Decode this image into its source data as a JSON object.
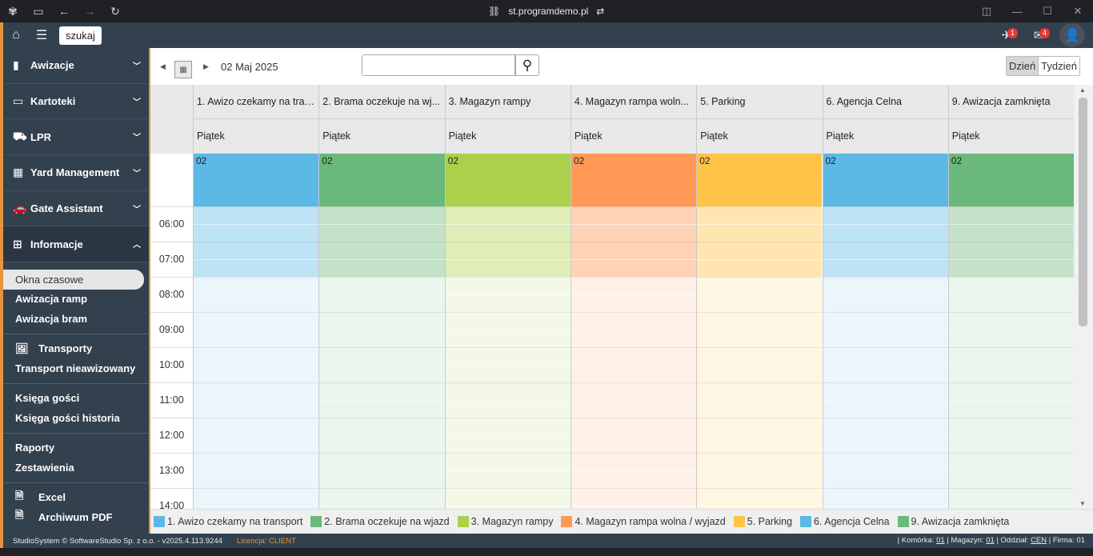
{
  "browser": {
    "url": "st.programdemo.pl"
  },
  "topbar": {
    "search_label": "szukaj",
    "notif1_count": "1",
    "notif2_count": "4"
  },
  "sidebar": {
    "sections": [
      {
        "label": "Awizacje",
        "icon": "clipboard-icon"
      },
      {
        "label": "Kartoteki",
        "icon": "folder-icon"
      },
      {
        "label": "LPR",
        "icon": "truck-icon"
      },
      {
        "label": "Yard Management",
        "icon": "grid-icon"
      },
      {
        "label": "Gate Assistant",
        "icon": "car-icon"
      },
      {
        "label": "Informacje",
        "icon": "sitemap-icon"
      }
    ],
    "items": {
      "okna": "Okna czasowe",
      "awizacja_ramp": "Awizacja ramp",
      "awizacja_bram": "Awizacja bram",
      "transporty": "Transporty",
      "transport_nieaw": "Transport nieawizowany",
      "ksiega": "Księga gości",
      "ksiega_hist": "Księga gości historia",
      "raporty": "Raporty",
      "zestawienia": "Zestawienia",
      "excel": "Excel",
      "archiwum": "Archiwum PDF"
    }
  },
  "toolbar": {
    "date": "02 Maj 2025",
    "search_value": "",
    "view_day": "Dzień",
    "view_week": "Tydzień"
  },
  "calendar": {
    "day_label": "Piątek",
    "allday_number": "02",
    "columns": [
      {
        "title": "1. Awizo czekamy na tran...",
        "color": "#5cb8e4",
        "dark": "#bde3f4",
        "light": "#eaf5fc"
      },
      {
        "title": "2. Brama oczekuje na wj...",
        "color": "#6ab87b",
        "dark": "#c3e2c8",
        "light": "#eaf5ec"
      },
      {
        "title": "3. Magazyn rampy",
        "color": "#acd04b",
        "dark": "#dfedb8",
        "light": "#f3f9e6"
      },
      {
        "title": "4. Magazyn rampa woln...",
        "color": "#ff9955",
        "dark": "#ffd2b6",
        "light": "#fff1e8"
      },
      {
        "title": "5. Parking",
        "color": "#ffc348",
        "dark": "#ffe6b0",
        "light": "#fff6e3"
      },
      {
        "title": "6. Agencja Celna",
        "color": "#5cb8e4",
        "dark": "#bde3f4",
        "light": "#eaf5fc"
      },
      {
        "title": "9. Awizacja zamknięta",
        "color": "#6ab87b",
        "dark": "#c3e2c8",
        "light": "#eaf5ec"
      }
    ],
    "times": [
      "06:00",
      "07:00",
      "08:00",
      "09:00",
      "10:00",
      "11:00",
      "12:00",
      "13:00",
      "14:00"
    ]
  },
  "legend": [
    {
      "label": "1. Awizo czekamy na transport",
      "color": "#5cb8e4"
    },
    {
      "label": "2. Brama oczekuje na wjazd",
      "color": "#6ab87b"
    },
    {
      "label": "3. Magazyn rampy",
      "color": "#acd04b"
    },
    {
      "label": "4. Magazyn rampa wolna / wyjazd",
      "color": "#ff9955"
    },
    {
      "label": "5. Parking",
      "color": "#ffc348"
    },
    {
      "label": "6. Agencja Celna",
      "color": "#5cb8e4"
    },
    {
      "label": "9. Awizacja zamknięta",
      "color": "#6ab87b"
    }
  ],
  "footer": {
    "copyright": "StudioSystem © SoftwareStudio Sp. z o.o. - v2025.4.113.9244",
    "license": "Licencja: CLIENT",
    "komorka_label": "| Komórka:",
    "komorka": "01",
    "magazyn_label": "| Magazyn:",
    "magazyn": "01",
    "oddzial_label": "| Oddział:",
    "oddzial": "CEN",
    "firma_label": "| Firma:",
    "firma": "01"
  }
}
